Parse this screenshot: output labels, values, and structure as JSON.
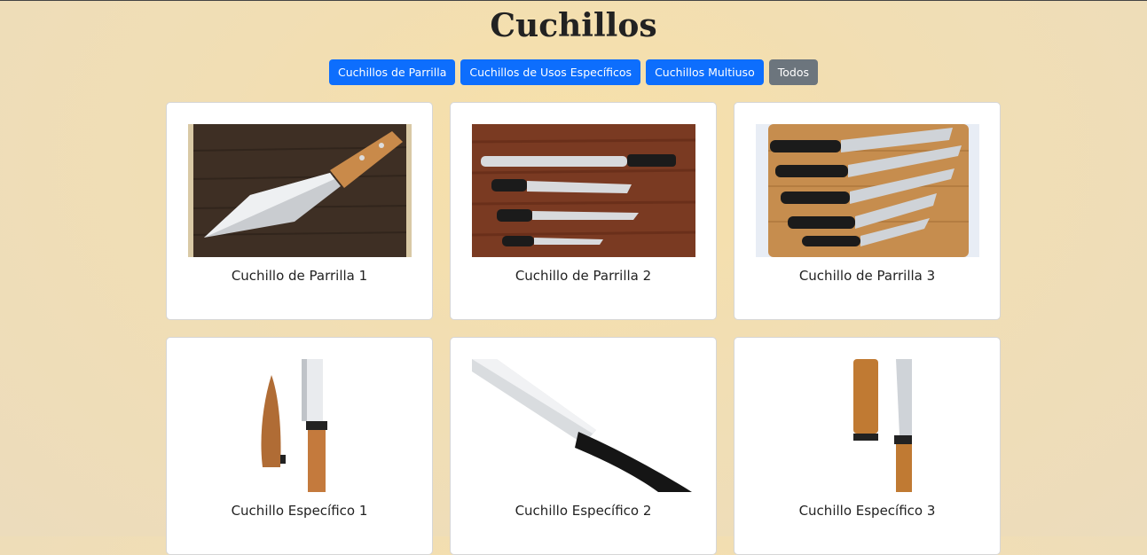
{
  "page": {
    "title": "Cuchillos"
  },
  "filters": [
    {
      "label": "Cuchillos de Parrilla",
      "variant": "primary"
    },
    {
      "label": "Cuchillos de Usos Específicos",
      "variant": "primary"
    },
    {
      "label": "Cuchillos Multiuso",
      "variant": "primary"
    },
    {
      "label": "Todos",
      "variant": "secondary"
    }
  ],
  "cards": [
    {
      "title": "Cuchillo de Parrilla 1",
      "image": "cleaver-knife-on-dark-wood-board"
    },
    {
      "title": "Cuchillo de Parrilla 2",
      "image": "four-knives-on-red-wood"
    },
    {
      "title": "Cuchillo de Parrilla 3",
      "image": "five-knives-on-bamboo-board"
    },
    {
      "title": "Cuchillo Específico 1",
      "image": "knife-with-wooden-sheath"
    },
    {
      "title": "Cuchillo Específico 2",
      "image": "serrated-bread-knife-black-handle"
    },
    {
      "title": "Cuchillo Específico 3",
      "image": "japanese-knife-with-saya"
    }
  ],
  "colors": {
    "primary": "#0d6efd",
    "secondary": "#6c757d",
    "background": "#f1deb4"
  }
}
